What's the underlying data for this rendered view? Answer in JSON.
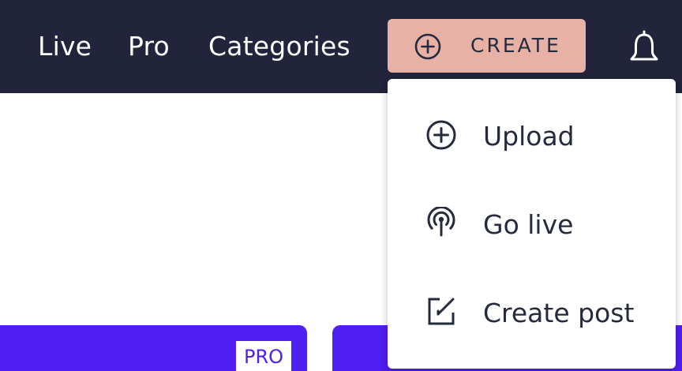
{
  "nav": {
    "links": [
      {
        "label": "Live"
      },
      {
        "label": "Pro"
      },
      {
        "label": "Categories"
      }
    ],
    "create_label": "CREATE",
    "create_icon": "plus-circle-icon",
    "bell_icon": "bell-icon"
  },
  "dropdown": {
    "items": [
      {
        "label": "Upload",
        "icon": "plus-circle-icon"
      },
      {
        "label": "Go live",
        "icon": "broadcast-icon"
      },
      {
        "label": "Create post",
        "icon": "edit-icon"
      }
    ]
  },
  "cards": {
    "badge": "PRO"
  },
  "colors": {
    "topbar": "#21243a",
    "create_button": "#e8b1a5",
    "card": "#4f1ef0",
    "text_dark": "#262a3d"
  }
}
